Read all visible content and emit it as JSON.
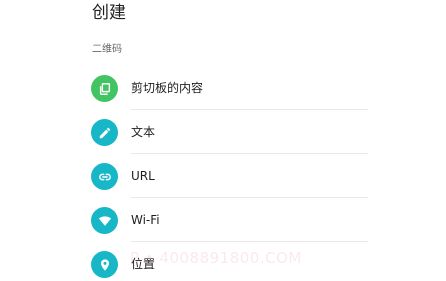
{
  "page": {
    "title": "创建"
  },
  "section": {
    "header": "二维码"
  },
  "items": [
    {
      "label": "剪切板的内容",
      "icon": "clipboard-copy-icon",
      "color": "#43c463"
    },
    {
      "label": "文本",
      "icon": "pencil-icon",
      "color": "#17b7c8"
    },
    {
      "label": "URL",
      "icon": "link-icon",
      "color": "#17b7c8"
    },
    {
      "label": "Wi-Fi",
      "icon": "wifi-icon",
      "color": "#17b7c8"
    },
    {
      "label": "位置",
      "icon": "location-pin-icon",
      "color": "#17b7c8"
    }
  ],
  "watermark": {
    "text": "P • 4008891800.COM"
  }
}
